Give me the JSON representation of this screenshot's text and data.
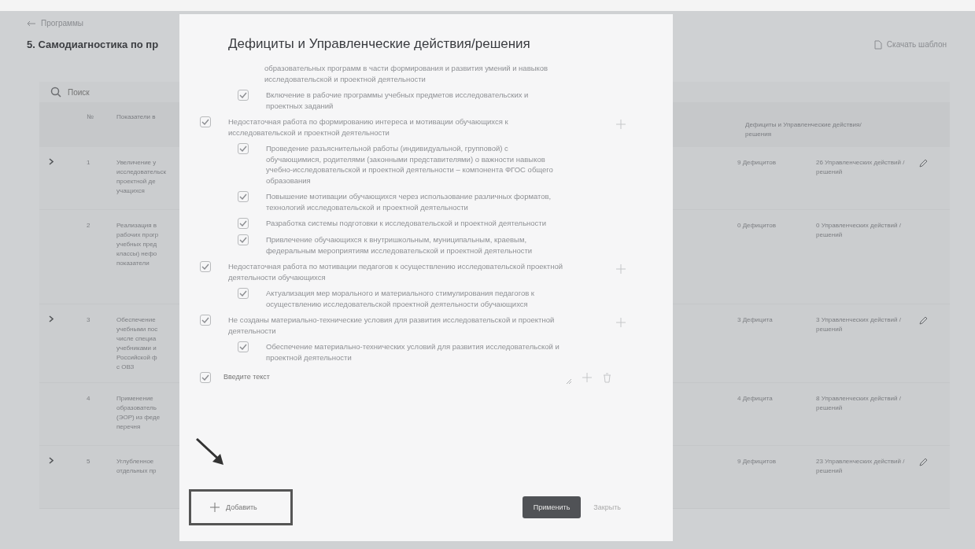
{
  "breadcrumb": {
    "label": "Программы"
  },
  "page_title": "5. Самодиагностика по пр",
  "download_button": "Скачать шаблон",
  "search": {
    "placeholder": "Поиск"
  },
  "table": {
    "columns": [
      "№",
      "Показатели в",
      "Дефициты и Управленческие действия/решения"
    ],
    "rows": [
      {
        "expandable": true,
        "number": "1",
        "indicator": [
          "Увеличение у",
          "исследовательск",
          "проектной де",
          "учащихся"
        ],
        "deficits": "9 Дефицитов",
        "actions": "26 Управленческих действий / решений",
        "editable": true
      },
      {
        "expandable": false,
        "number": "2",
        "indicator": [
          "Реализация в",
          "рабочих прогр",
          "учебных пред",
          "классы) нефо",
          "показатели"
        ],
        "deficits": "0 Дефицитов",
        "actions": "0 Управленческих действий / решений",
        "editable": false
      },
      {
        "expandable": true,
        "number": "3",
        "indicator": [
          "Обеспечение",
          "учебными пос",
          "числе специа",
          "учебниками и",
          "Российской ф",
          "с ОВЗ"
        ],
        "deficits": "3 Дефицита",
        "actions": "3 Управленческих действий / решений",
        "editable": true
      },
      {
        "expandable": false,
        "number": "4",
        "indicator": [
          "Применение",
          "образователь",
          "(ЭОР) из феде",
          "перечня"
        ],
        "deficits": "4 Дефицита",
        "actions": "8 Управленческих действий / решений",
        "editable": false
      },
      {
        "expandable": true,
        "number": "5",
        "indicator": [
          "Углубленное",
          "отдельных пр"
        ],
        "deficits": "9 Дефицитов",
        "actions": "23 Управленческих действий / решений",
        "editable": true
      }
    ]
  },
  "modal": {
    "title": "Дефициты и Управленческие действия/решения",
    "items": [
      {
        "kind": "cut",
        "text": "образовательных программ в части формирования и развития умений и навыков исследовательской и проектной деятельности"
      },
      {
        "kind": "action",
        "checked": true,
        "text": "Включение в рабочие программы учебных предметов исследовательских и проектных заданий"
      },
      {
        "kind": "deficit",
        "checked": true,
        "text": "Недостаточная работа по формированию интереса и мотивации обучающихся к исследовательской и проектной деятельности"
      },
      {
        "kind": "action",
        "checked": true,
        "text": "Проведение разъяснительной работы (индивидуальной, групповой) с обучающимися, родителями (законными представителями) о важности навыков учебно-исследовательской и проектной деятельности – компонента ФГОС общего образования"
      },
      {
        "kind": "action",
        "checked": true,
        "text": "Повышение мотивации обучающихся через использование различных форматов, технологий исследовательской и проектной деятельности"
      },
      {
        "kind": "action",
        "checked": true,
        "text": "Разработка системы подготовки к исследовательской и проектной деятельности"
      },
      {
        "kind": "action",
        "checked": true,
        "text": "Привлечение обучающихся к внутришкольным, муниципальным, краевым, федеральным мероприятиям исследовательской и проектной деятельности"
      },
      {
        "kind": "deficit",
        "checked": true,
        "text": "Недостаточная работа по мотивации педагогов к осуществлению исследовательской проектной деятельности обучающихся"
      },
      {
        "kind": "action",
        "checked": true,
        "text": "Актуализация мер морального и материального стимулирования педагогов к осуществлению исследовательской проектной деятельности обучающихся"
      },
      {
        "kind": "deficit",
        "checked": true,
        "text": "Не созданы материально-технические условия для развития исследовательской и проектной деятельности"
      },
      {
        "kind": "action",
        "checked": true,
        "text": "Обеспечение материально-технических условий для развития исследовательской и проектной деятельности"
      },
      {
        "kind": "new",
        "checked": true,
        "placeholder": "Введите текст"
      }
    ],
    "add_button": "Добавить",
    "apply_button": "Применить",
    "close_button": "Закрыть"
  }
}
